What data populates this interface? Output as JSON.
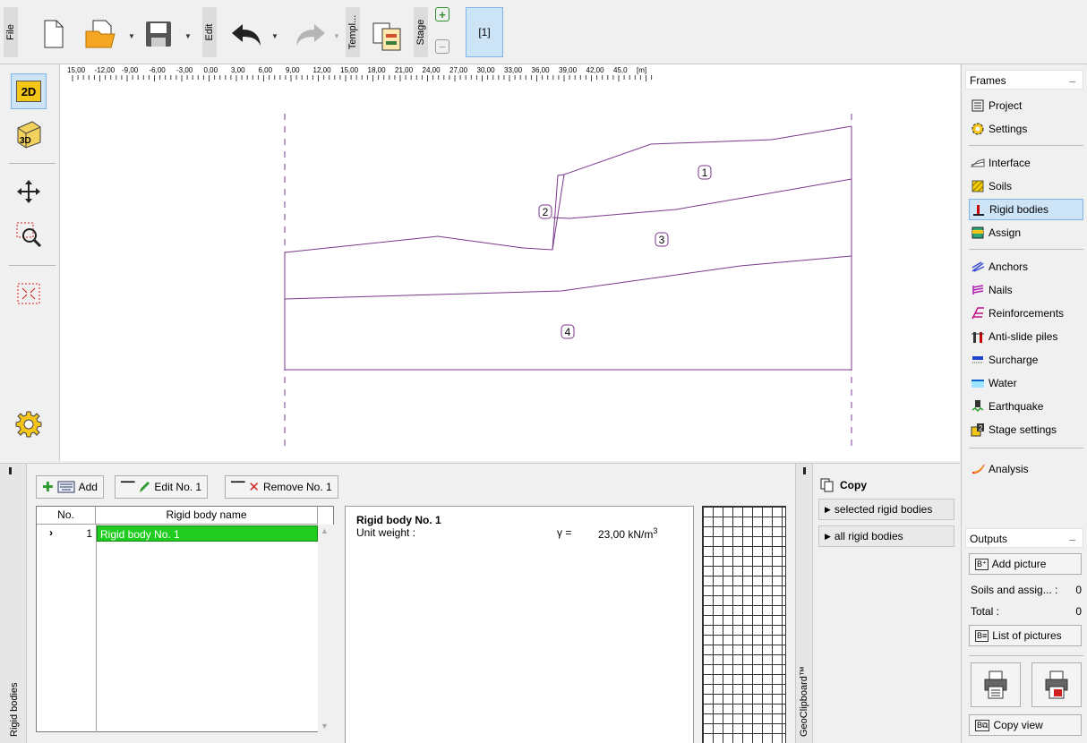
{
  "ribbon": {
    "file_label": "File",
    "edit_label": "Edit",
    "templ_label": "Templ...",
    "stage_label": "Stage",
    "stage_tab": "[1]"
  },
  "left_toolbar": {
    "view_2d": "2D",
    "view_3d": "3D"
  },
  "ruler": {
    "ticks": [
      "15,00",
      "-12,00",
      "-9,00",
      "-6,00",
      "-3,00",
      "0,00",
      "3,00",
      "6,00",
      "9,00",
      "12,00",
      "15,00",
      "18,00",
      "21,00",
      "24,00",
      "27,00",
      "30,00",
      "33,00",
      "36,00",
      "39,00",
      "42,00",
      "45,0"
    ],
    "unit": "[m]"
  },
  "canvas": {
    "region_labels": [
      "1",
      "2",
      "3",
      "4"
    ]
  },
  "bottom": {
    "side_tab": "Rigid bodies",
    "add_label": "Add",
    "edit_label": "Edit No. 1",
    "remove_label": "Remove No. 1",
    "table": {
      "headers": [
        "No.",
        "Rigid body name"
      ],
      "rows": [
        {
          "no": "1",
          "name": "Rigid body No. 1"
        }
      ]
    },
    "info": {
      "title": "Rigid body No. 1",
      "param_label": "Unit weight :",
      "symbol": "γ =",
      "value": "23,00 kN/m",
      "unit_sup": "3"
    },
    "clipboard_tab": "GeoClipboard™",
    "copy_title": "Copy",
    "copy_selected": "selected rigid bodies",
    "copy_all": "all rigid bodies"
  },
  "frames": {
    "title": "Frames",
    "minimize": "_",
    "items": [
      {
        "label": "Project",
        "icon": "document-icon"
      },
      {
        "label": "Settings",
        "icon": "gear-icon"
      },
      {
        "label": "Interface",
        "icon": "interface-icon"
      },
      {
        "label": "Soils",
        "icon": "soils-icon"
      },
      {
        "label": "Rigid bodies",
        "icon": "rigid-body-icon"
      },
      {
        "label": "Assign",
        "icon": "assign-icon"
      },
      {
        "label": "Anchors",
        "icon": "anchor-icon"
      },
      {
        "label": "Nails",
        "icon": "nail-icon"
      },
      {
        "label": "Reinforcements",
        "icon": "reinforcement-icon"
      },
      {
        "label": "Anti-slide piles",
        "icon": "pile-icon"
      },
      {
        "label": "Surcharge",
        "icon": "surcharge-icon"
      },
      {
        "label": "Water",
        "icon": "water-icon"
      },
      {
        "label": "Earthquake",
        "icon": "earthquake-icon"
      },
      {
        "label": "Stage settings",
        "icon": "stage-settings-icon"
      },
      {
        "label": "Analysis",
        "icon": "analysis-icon"
      }
    ],
    "selected": "Rigid bodies"
  },
  "outputs": {
    "title": "Outputs",
    "minimize": "_",
    "add_picture": "Add picture",
    "soils_label": "Soils and assig... :",
    "soils_count": "0",
    "total_label": "Total :",
    "total_count": "0",
    "list_pictures": "List of pictures",
    "copy_view": "Copy view"
  },
  "colors": {
    "accent_selected": "#cde4f7",
    "row_selected": "#1fcc1f",
    "geometry_line": "#7a3a8c"
  }
}
